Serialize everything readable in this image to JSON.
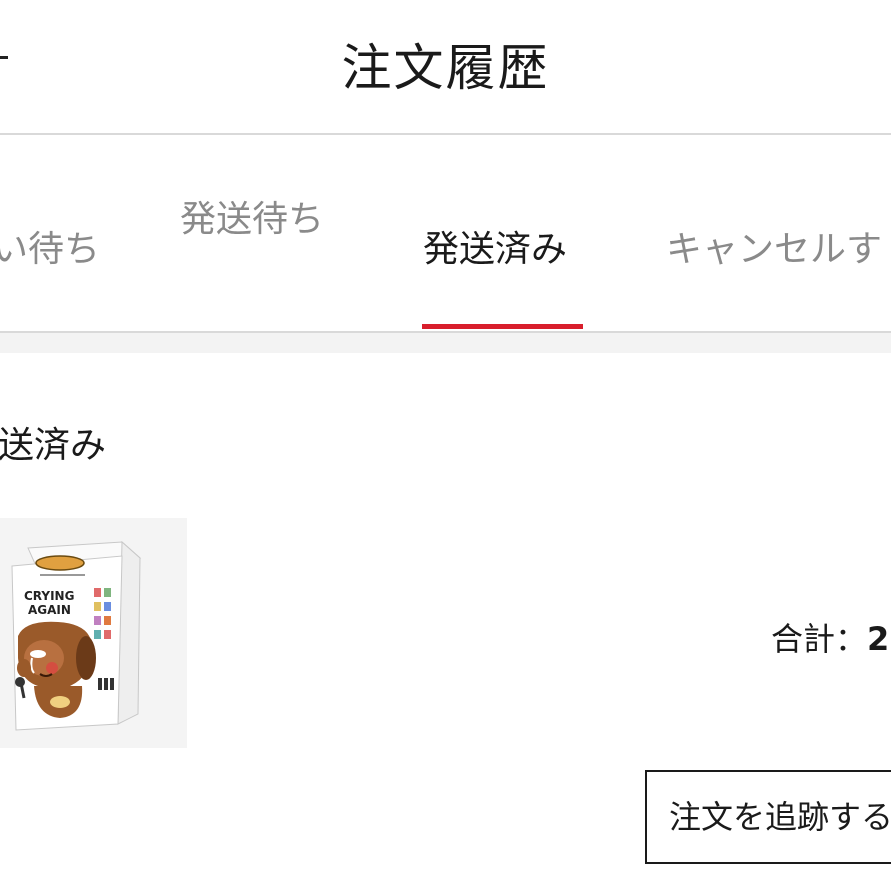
{
  "header": {
    "title": "注文履歴"
  },
  "tabs": [
    {
      "label": "い待ち",
      "active": false
    },
    {
      "label": "発送待ち",
      "active": false
    },
    {
      "label": "発送済み",
      "active": true
    },
    {
      "label": "キャンセルす",
      "active": false
    }
  ],
  "colors": {
    "active_tab_indicator": "#d81e2c",
    "section_band": "#f3f3f3",
    "inactive_tab_text": "#8a8a8a"
  },
  "order": {
    "status": "送済み",
    "product": {
      "box_title_line1": "CRYING",
      "box_title_line2": "AGAIN",
      "image_icon": "crying-character-box"
    },
    "total_label": "合計：",
    "total_amount": "2",
    "track_button_label": "注文を追跡する"
  }
}
